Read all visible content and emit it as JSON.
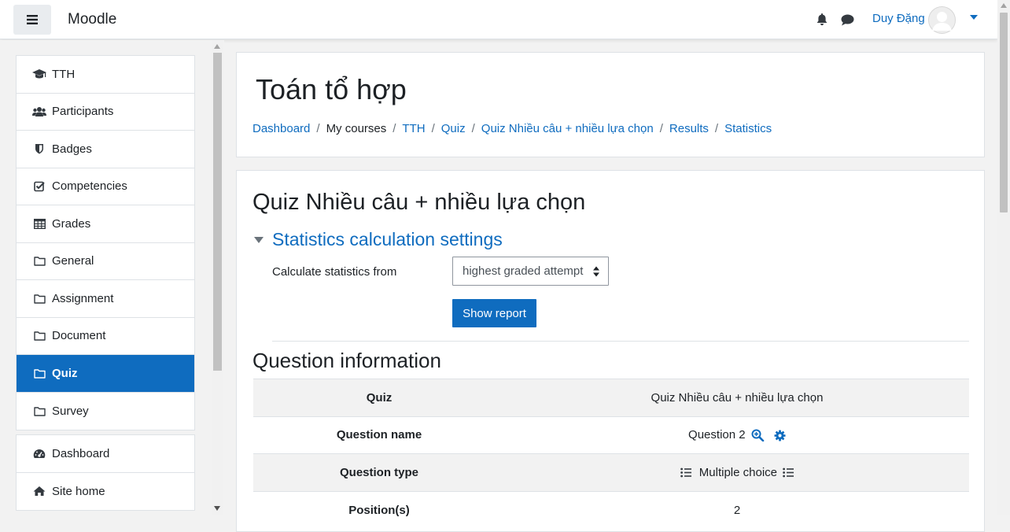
{
  "navbar": {
    "brand": "Moodle",
    "user_name": "Duy Đặng"
  },
  "drawer": {
    "course_items": [
      {
        "label": "TTH",
        "icon": "graduation-cap-icon"
      },
      {
        "label": "Participants",
        "icon": "users-icon"
      },
      {
        "label": "Badges",
        "icon": "shield-icon"
      },
      {
        "label": "Competencies",
        "icon": "check-square-icon"
      },
      {
        "label": "Grades",
        "icon": "table-icon"
      },
      {
        "label": "General",
        "icon": "folder-icon"
      },
      {
        "label": "Assignment",
        "icon": "folder-icon"
      },
      {
        "label": "Document",
        "icon": "folder-icon"
      },
      {
        "label": "Quiz",
        "icon": "folder-icon",
        "active": true
      },
      {
        "label": "Survey",
        "icon": "folder-icon"
      }
    ],
    "site_items": [
      {
        "label": "Dashboard",
        "icon": "tachometer-icon"
      },
      {
        "label": "Site home",
        "icon": "home-icon"
      }
    ]
  },
  "header": {
    "course_title": "Toán tổ hợp",
    "breadcrumb": [
      "Dashboard",
      "My courses",
      "TTH",
      "Quiz",
      "Quiz Nhiều câu + nhiều lựa chọn",
      "Results",
      "Statistics"
    ],
    "breadcrumb_separator": "/"
  },
  "main": {
    "quiz_title": "Quiz Nhiều câu + nhiều lựa chọn",
    "settings_heading": "Statistics calculation settings",
    "calc_label": "Calculate statistics from",
    "calc_select_value": "highest graded attempt",
    "show_report_label": "Show report",
    "question_info_heading": "Question information",
    "table": [
      {
        "key": "Quiz",
        "value": "Quiz Nhiều câu + nhiều lựa chọn"
      },
      {
        "key": "Question name",
        "value": "Question 2"
      },
      {
        "key": "Question type",
        "value": "Multiple choice"
      },
      {
        "key": "Position(s)",
        "value": "2"
      }
    ]
  },
  "colors": {
    "accent": "#0f6cbf",
    "text": "#1d2125",
    "background": "#f2f2f2"
  }
}
